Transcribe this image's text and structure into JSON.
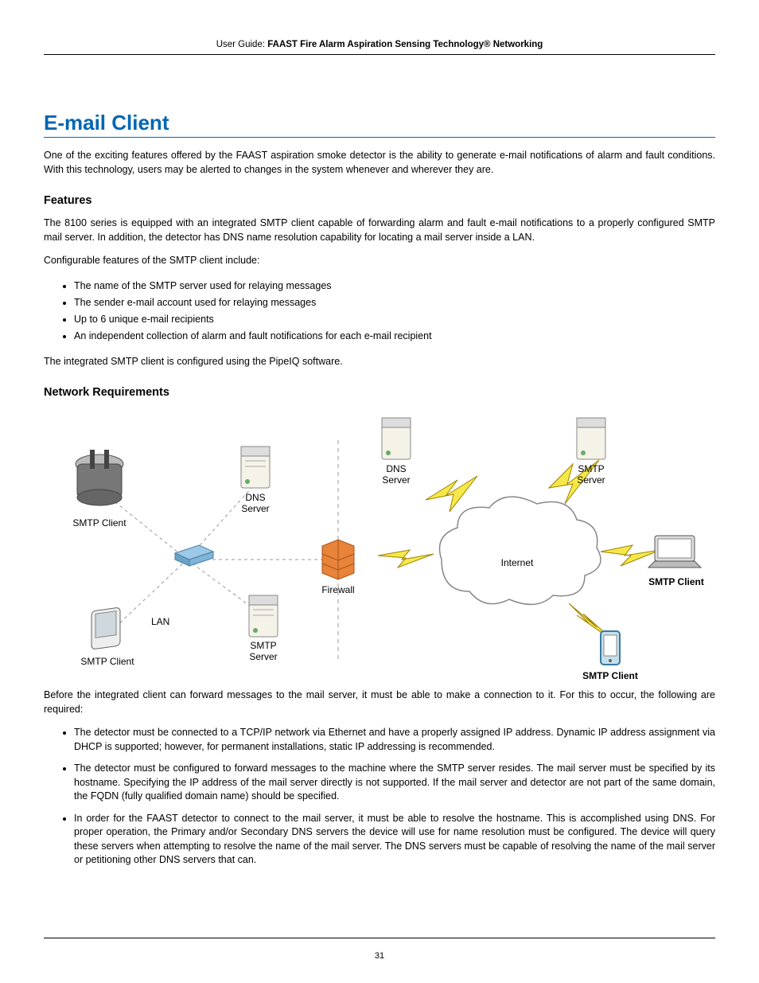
{
  "header": {
    "prefix": "User Guide: ",
    "title": "FAAST Fire Alarm Aspiration Sensing Technology® Networking"
  },
  "page_title": "E-mail Client",
  "intro": "One of the exciting features offered by the FAAST aspiration smoke detector is the ability to generate e-mail notifications of alarm and fault conditions. With this technology, users may be alerted to changes in the system whenever and wherever they are.",
  "features": {
    "heading": "Features",
    "p1": "The 8100 series is equipped with an integrated SMTP client capable of forwarding alarm and fault e-mail notifications to a properly configured SMTP mail server. In addition, the detector has DNS name resolution capability for locating a mail server inside a LAN.",
    "p2": "Configurable features of the SMTP client include:",
    "bullets": [
      "The name of the SMTP server used for relaying messages",
      "The sender e-mail account used for relaying messages",
      "Up to 6 unique e-mail recipients",
      "An independent collection of alarm and fault notifications for each e-mail recipient"
    ],
    "p3": "The integrated SMTP client is configured using the PipeIQ software."
  },
  "network": {
    "heading": "Network Requirements",
    "p1": "Before the integrated client can forward messages to the mail server, it must be able to make a connection to it. For this to occur, the following are required:",
    "bullets": [
      "The detector must be connected to a TCP/IP network via Ethernet and have a properly assigned IP address. Dynamic IP address assignment via DHCP is supported; however, for permanent installations, static IP addressing is recommended.",
      "The detector must be configured to forward messages to the machine where the SMTP server resides. The mail server must be specified by its hostname. Specifying the IP address of the mail server directly is not supported. If the mail server and detector are not part of the same domain, the FQDN (fully qualified domain name) should be specified.",
      "In order for the FAAST detector to connect to the mail server, it must be able to resolve the hostname. This is accomplished using DNS. For proper operation, the Primary and/or Secondary DNS servers the device will use for name resolution must be configured. The device will query these servers when attempting to resolve the name of the mail server. The DNS servers must be capable of resolving the name of the mail server or petitioning other DNS servers that can."
    ]
  },
  "diagram": {
    "labels": {
      "smtp_client_tl": "SMTP Client",
      "smtp_client_bl": "SMTP Client",
      "smtp_client_r1": "SMTP Client",
      "smtp_client_r2": "SMTP Client",
      "dns_server_left": "DNS\nServer",
      "dns_server_right": "DNS\nServer",
      "smtp_server_left": "SMTP\nServer",
      "smtp_server_right": "SMTP\nServer",
      "lan": "LAN",
      "firewall": "Firewall",
      "internet": "Internet"
    }
  },
  "page_number": "31"
}
